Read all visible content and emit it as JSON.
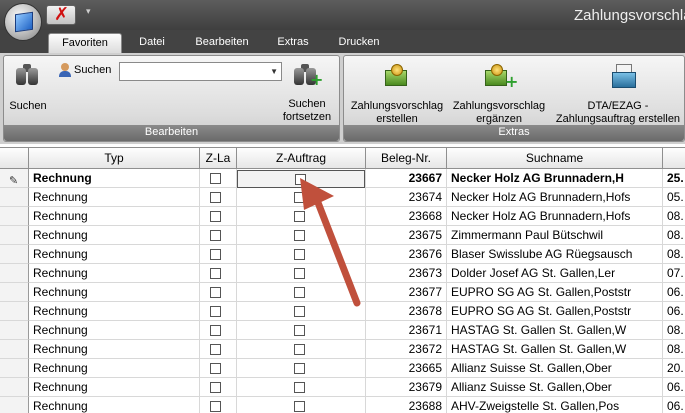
{
  "title": "Zahlungsvorschla",
  "quick_access": {
    "cancel_glyph": "✗",
    "dropdown_glyph": "▾"
  },
  "tabs": [
    "Favoriten",
    "Datei",
    "Bearbeiten",
    "Extras",
    "Drucken"
  ],
  "ribbon": {
    "bearbeiten": {
      "label": "Bearbeiten",
      "search_button": "Suchen",
      "search_label": "Suchen",
      "search_value": "",
      "search_next_line1": "Suchen",
      "search_next_line2": "fortsetzen"
    },
    "extras": {
      "label": "Extras",
      "zv_create_line1": "Zahlungsvorschlag",
      "zv_create_line2": "erstellen",
      "zv_extend_line1": "Zahlungsvorschlag",
      "zv_extend_line2": "ergänzen",
      "dta_line1": "DTA/EZAG -",
      "dta_line2": "Zahlungsauftrag erstellen"
    }
  },
  "grid": {
    "columns": [
      "Typ",
      "Z-La",
      "Z-Auftrag",
      "Beleg-Nr.",
      "Suchname"
    ],
    "rows": [
      {
        "typ": "Rechnung",
        "beleg": "23667",
        "suchname": "Necker Holz AG Brunnadern,H",
        "datum": "25."
      },
      {
        "typ": "Rechnung",
        "beleg": "23674",
        "suchname": "Necker Holz AG Brunnadern,Hofs",
        "datum": "05."
      },
      {
        "typ": "Rechnung",
        "beleg": "23668",
        "suchname": "Necker Holz AG Brunnadern,Hofs",
        "datum": "08."
      },
      {
        "typ": "Rechnung",
        "beleg": "23675",
        "suchname": "Zimmermann Paul Bütschwil",
        "datum": "08."
      },
      {
        "typ": "Rechnung",
        "beleg": "23676",
        "suchname": "Blaser Swisslube AG Rüegsausch",
        "datum": "08."
      },
      {
        "typ": "Rechnung",
        "beleg": "23673",
        "suchname": "Dolder Josef AG St. Gallen,Ler",
        "datum": "07."
      },
      {
        "typ": "Rechnung",
        "beleg": "23677",
        "suchname": "EUPRO SG AG St. Gallen,Poststr",
        "datum": "06."
      },
      {
        "typ": "Rechnung",
        "beleg": "23678",
        "suchname": "EUPRO SG AG St. Gallen,Poststr",
        "datum": "06."
      },
      {
        "typ": "Rechnung",
        "beleg": "23671",
        "suchname": "HASTAG St. Gallen St. Gallen,W",
        "datum": "08."
      },
      {
        "typ": "Rechnung",
        "beleg": "23672",
        "suchname": "HASTAG St. Gallen St. Gallen,W",
        "datum": "08."
      },
      {
        "typ": "Rechnung",
        "beleg": "23665",
        "suchname": "Allianz Suisse St. Gallen,Ober",
        "datum": "20."
      },
      {
        "typ": "Rechnung",
        "beleg": "23679",
        "suchname": "Allianz Suisse St. Gallen,Ober",
        "datum": "06."
      },
      {
        "typ": "Rechnung",
        "beleg": "23688",
        "suchname": "AHV-Zweigstelle St. Gallen,Pos",
        "datum": "06."
      }
    ]
  },
  "colors": {
    "arrow": "#c0503c",
    "titlebar": "#4a4a4a",
    "ribbon": "#cfcfcf"
  },
  "icons": [
    "app-orb-icon",
    "cancel-icon",
    "binoculars-icon",
    "user-icon",
    "binoculars-plus-icon",
    "payment-proposal-icon",
    "dta-icon",
    "pencil-icon",
    "arrow-annotation"
  ]
}
